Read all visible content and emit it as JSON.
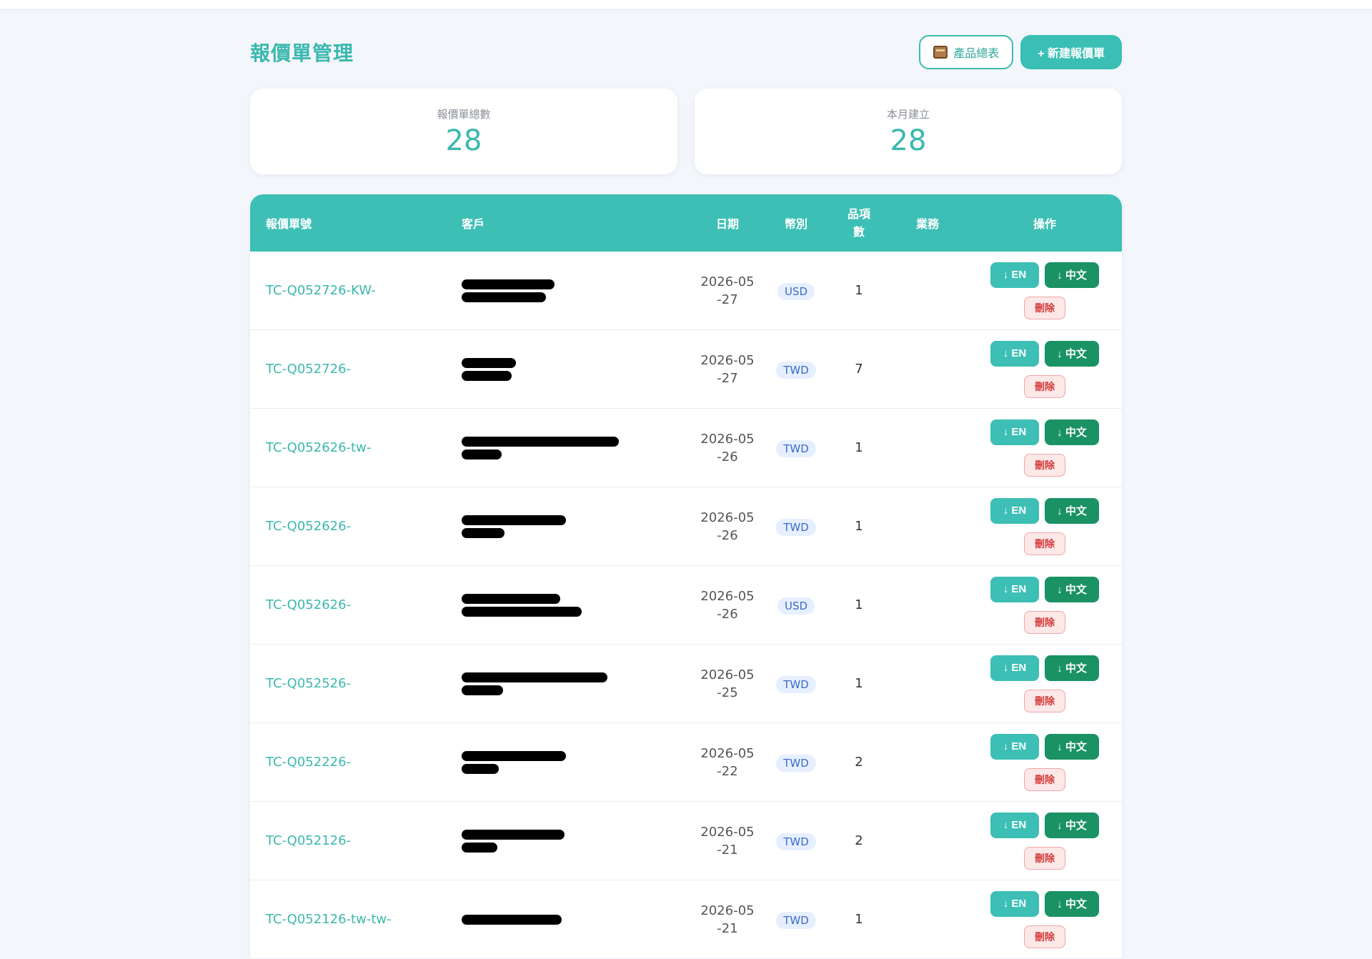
{
  "header": {
    "title": "報價單管理",
    "product_button": "產品總表",
    "new_button": "+ 新建報價單"
  },
  "stats": [
    {
      "label": "報價單總數",
      "value": "28"
    },
    {
      "label": "本月建立",
      "value": "28"
    }
  ],
  "table": {
    "columns": {
      "id": "報價單號",
      "client": "客戶",
      "date": "日期",
      "currency": "幣別",
      "items": "品項數",
      "sales": "業務",
      "ops": "操作"
    },
    "buttons": {
      "en": "↓ EN",
      "zh": "↓ 中文",
      "delete": "刪除"
    },
    "rows": [
      {
        "id": "TC-Q052726-KW-",
        "date": "2026-05-27",
        "currency": "USD",
        "items": "1"
      },
      {
        "id": "TC-Q052726-",
        "date": "2026-05-27",
        "currency": "TWD",
        "items": "7"
      },
      {
        "id": "TC-Q052626-tw-",
        "date": "2026-05-26",
        "currency": "TWD",
        "items": "1"
      },
      {
        "id": "TC-Q052626-",
        "date": "2026-05-26",
        "currency": "TWD",
        "items": "1"
      },
      {
        "id": "TC-Q052626-",
        "date": "2026-05-26",
        "currency": "USD",
        "items": "1"
      },
      {
        "id": "TC-Q052526-",
        "date": "2026-05-25",
        "currency": "TWD",
        "items": "1"
      },
      {
        "id": "TC-Q052226-",
        "date": "2026-05-22",
        "currency": "TWD",
        "items": "2"
      },
      {
        "id": "TC-Q052126-",
        "date": "2026-05-21",
        "currency": "TWD",
        "items": "2"
      },
      {
        "id": "TC-Q052126-tw-tw-",
        "date": "2026-05-21",
        "currency": "TWD",
        "items": "1"
      }
    ]
  }
}
